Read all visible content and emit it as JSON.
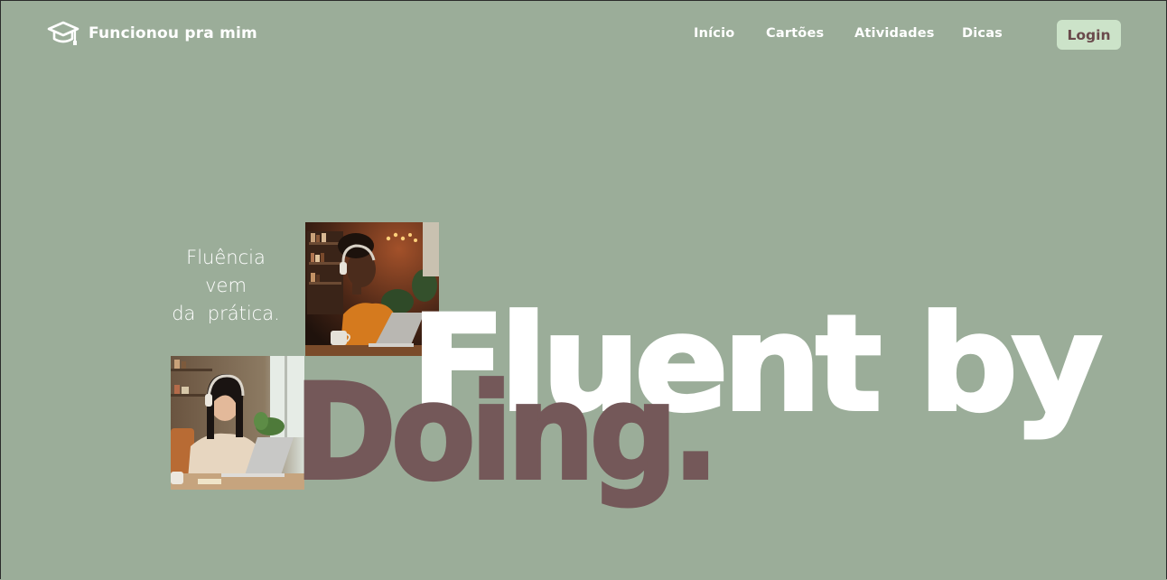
{
  "brand": {
    "name": "Funcionou pra mim",
    "icon": "graduation-cap-icon"
  },
  "nav": {
    "items": [
      "Início",
      "Cartões",
      "Atividades",
      "Dicas"
    ]
  },
  "login": {
    "label": "Login"
  },
  "hero": {
    "tagline_lines": [
      "Fluência",
      "vem",
      "da  prática."
    ],
    "headline_line1": "Fluent by",
    "headline_line2": "Doing."
  },
  "colors": {
    "background": "#9bad99",
    "login_bg": "#cce3c9",
    "accent_mauve": "#745859",
    "text_light": "#ffffff"
  }
}
